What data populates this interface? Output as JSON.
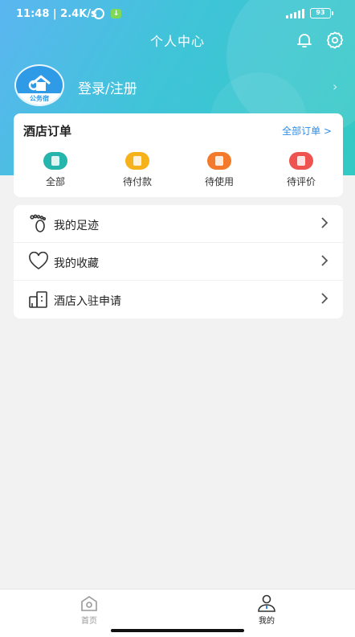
{
  "status_bar": {
    "time": "11:48 | 2.4K/s",
    "network": "4G",
    "battery": "93"
  },
  "header": {
    "title": "个人中心",
    "icons": [
      "bell-icon",
      "gear-icon"
    ]
  },
  "profile": {
    "avatar_text": "公务宿",
    "login_label": "登录/注册"
  },
  "orders": {
    "title": "酒店订单",
    "all_link": "全部订单 >",
    "items": [
      {
        "label": "全部",
        "icon": "clipboard-icon",
        "color": "#26b5ad"
      },
      {
        "label": "待付款",
        "icon": "wallet-icon",
        "color": "#f6b21b"
      },
      {
        "label": "待使用",
        "icon": "ticket-icon",
        "color": "#f37a2a"
      },
      {
        "label": "待评价",
        "icon": "rating-icon",
        "color": "#ef5350"
      }
    ]
  },
  "menu": {
    "items": [
      {
        "label": "我的足迹",
        "icon": "footprint-icon"
      },
      {
        "label": "我的收藏",
        "icon": "heart-icon"
      },
      {
        "label": "酒店入驻申请",
        "icon": "building-icon"
      }
    ]
  },
  "tabbar": {
    "items": [
      {
        "label": "首页",
        "icon": "home-icon",
        "active": false
      },
      {
        "label": "我的",
        "icon": "user-icon",
        "active": true
      }
    ]
  },
  "colors": {
    "accent": "#2e8de8",
    "header_gradient_start": "#5bb6f0",
    "header_gradient_end": "#33c9c3"
  }
}
